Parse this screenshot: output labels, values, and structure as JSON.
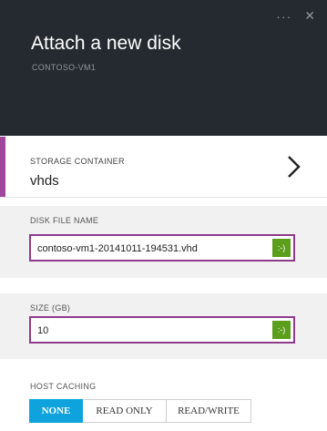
{
  "header": {
    "menu_icon": "ellipsis-icon",
    "close_icon": "close-icon",
    "menu_glyph": "···",
    "close_glyph": "✕",
    "title": "Attach a new disk",
    "subtitle": "CONTOSO-VM1"
  },
  "storage": {
    "label": "STORAGE CONTAINER",
    "value": "vhds",
    "chevron_icon": "chevron-right-icon"
  },
  "disk_file": {
    "label": "DISK FILE NAME",
    "value": "contoso-vm1-20141011-194531.vhd",
    "badge": ":-)"
  },
  "size": {
    "label": "SIZE (GB)",
    "value": "10",
    "badge": ":-)"
  },
  "host_caching": {
    "label": "HOST CACHING",
    "options": [
      "NONE",
      "READ ONLY",
      "READ/WRITE"
    ],
    "selected": "NONE"
  },
  "colors": {
    "header_bg": "#242a30",
    "accent_purple": "#a0479b",
    "valid_green": "#5b9e1c",
    "selected_blue": "#0fa3dd"
  }
}
